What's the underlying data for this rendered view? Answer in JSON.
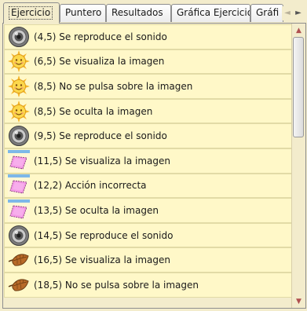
{
  "tabs": [
    {
      "label": "Ejercicio",
      "active": true
    },
    {
      "label": "Puntero",
      "active": false
    },
    {
      "label": "Resultados",
      "active": false
    },
    {
      "label": "Gráfica Ejercicio",
      "active": false
    },
    {
      "label": "Gráfi",
      "active": false
    }
  ],
  "tab_scroll": {
    "left_arrow": "◄",
    "right_arrow": "►"
  },
  "scrollbar": {
    "up_arrow": "▲",
    "down_arrow": "▼"
  },
  "events": [
    {
      "icon": "speaker-icon",
      "text": "(4,5) Se reproduce el sonido"
    },
    {
      "icon": "sun-icon",
      "text": "(6,5) Se visualiza la imagen"
    },
    {
      "icon": "sun-icon",
      "text": "(8,5) No se pulsa sobre la imagen"
    },
    {
      "icon": "sun-icon",
      "text": "(8,5) Se oculta la imagen"
    },
    {
      "icon": "speaker-icon",
      "text": "(9,5) Se reproduce el sonido"
    },
    {
      "icon": "pink-card-icon",
      "text": "(11,5) Se visualiza la imagen"
    },
    {
      "icon": "pink-card-icon",
      "text": "(12,2) Acción incorrecta"
    },
    {
      "icon": "pink-card-icon",
      "text": "(13,5) Se oculta la imagen"
    },
    {
      "icon": "speaker-icon",
      "text": "(14,5) Se reproduce el sonido"
    },
    {
      "icon": "leaf-icon",
      "text": "(16,5) Se visualiza la imagen"
    },
    {
      "icon": "leaf-icon",
      "text": "(18,5) No se pulsa sobre la imagen"
    }
  ]
}
